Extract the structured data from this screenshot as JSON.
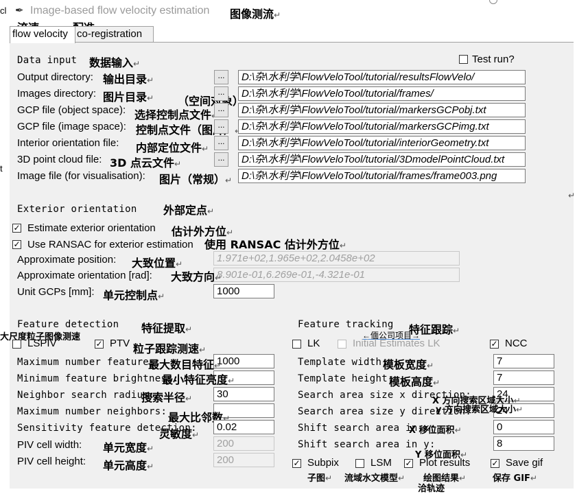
{
  "window": {
    "title": "Image-based flow velocity estimation",
    "title_zh": "图像测流",
    "edge_char_top": "cl",
    "edge_char_mid": "t"
  },
  "tabs": [
    {
      "label": "flow velocity",
      "zh": "流速"
    },
    {
      "label": "co-registration",
      "zh": "配准"
    }
  ],
  "data_input": {
    "heading": "Data input",
    "heading_zh": "数据输入",
    "test_run_label": "Test run?",
    "test_run_checked": false,
    "rows": [
      {
        "label": "Output directory:",
        "zh": "输出目录",
        "value": "D:\\杂\\水利学\\FlowVeloTool/tutorial/resultsFlowVelo/"
      },
      {
        "label": "Images directory:",
        "zh": "图片目录",
        "value": "D:\\杂\\水利学\\FlowVeloTool/tutorial/frames/"
      },
      {
        "label": "GCP file (object space):",
        "zh": "选择控制点文件",
        "value": "D:\\杂\\水利学\\FlowVeloTool/tutorial/markersGCPobj.txt"
      },
      {
        "label": "GCP file (image space):",
        "zh": "控制点文件（图片）",
        "value": "D:\\杂\\水利学\\FlowVeloTool/tutorial/markersGCPimg.txt"
      },
      {
        "label": "Interior orientation file:",
        "zh": "内部定位文件",
        "value": "D:\\杂\\水利学\\FlowVeloTool/tutorial/interiorGeometry.txt"
      },
      {
        "label": "3D point cloud file:",
        "zh": "3D 点云文件",
        "value": "D:\\杂\\水利学\\FlowVeloTool/tutorial/3DmodelPointCloud.txt"
      },
      {
        "label": "Image file (for visualisation):",
        "zh": "图片（常规）",
        "value": "D:\\杂\\水利学\\FlowVeloTool/tutorial/frames/frame003.png"
      }
    ],
    "object_space_zh": "（空间对象）",
    "browse_label": "..."
  },
  "exterior": {
    "heading": "Exterior orientation",
    "heading_zh": "外部定点",
    "estimate_label": "Estimate exterior orientation",
    "estimate_zh": "估计外方位",
    "estimate_checked": true,
    "ransac_label": "Use RANSAC for exterior estimation",
    "ransac_zh": "使用 RANSAC 估计外方位",
    "ransac_checked": true,
    "approx_pos_label": "Approximate position:",
    "approx_pos_zh": "大致位置",
    "approx_pos_value": "1.971e+02,1.965e+02,2.0458e+02",
    "approx_ori_label": "Approximate orientation [rad]:",
    "approx_ori_zh": "大致方向",
    "approx_ori_value": "8.901e-01,6.269e-01,-4.321e-01",
    "unit_label": "Unit GCPs [mm]:",
    "unit_zh": "单元控制点",
    "unit_value": "1000"
  },
  "feature_detection": {
    "heading": "Feature detection",
    "heading_zh": "特征提取",
    "lspiv_zh": "大尺度粒子图像测速",
    "lspiv_label": "LSPIV",
    "lspiv_checked": false,
    "ptv_label": "PTV",
    "ptv_zh": "粒子跟踪测速",
    "ptv_checked": true,
    "rows": [
      {
        "label": "Maximum number features:",
        "zh": "最大数目特征",
        "value": "1000",
        "disabled": false
      },
      {
        "label": "Minimum feature brightness:",
        "zh": "最小特征亮度",
        "value": "",
        "disabled": false
      },
      {
        "label": "Neighbor search radius:",
        "zh": "搜索半径",
        "value": "30",
        "disabled": false
      },
      {
        "label": "Maximum number neighbors:",
        "zh": "最大比邻数",
        "value": "",
        "disabled": false
      },
      {
        "label": "Sensitivity feature detection:",
        "zh": "灵敏度",
        "value": "0.02",
        "disabled": false
      },
      {
        "label": "PIV cell width:",
        "zh": "单元宽度",
        "value": "200",
        "disabled": true
      },
      {
        "label": "PIV cell height:",
        "zh": "单元高度",
        "value": "200",
        "disabled": true
      }
    ]
  },
  "feature_tracking": {
    "heading": "Feature tracking",
    "heading_zh": "特征跟踪",
    "note_zh": "←偭公司项目→",
    "lk_label": "LK",
    "lk_checked": false,
    "initial_label": "Initial Estimates LK",
    "initial_checked": false,
    "ncc_label": "NCC",
    "ncc_checked": true,
    "rows": [
      {
        "label": "Template width:",
        "zh": "模板宽度",
        "value": "7"
      },
      {
        "label": "Template height:",
        "zh": "模板高度",
        "value": "7"
      },
      {
        "label": "Search area size x direction:",
        "zh": "X 方向搜索区域大小",
        "value": "24"
      },
      {
        "label": "Search area size y direction:",
        "zh": "y 方向搜索区域大小",
        "value": "24"
      },
      {
        "label": "Shift search area in x:",
        "zh": "X 移位面积",
        "value": "0"
      },
      {
        "label": "Shift search area in y:",
        "zh": "Y 移位面积",
        "value": "8"
      }
    ]
  },
  "options": [
    {
      "label": "Subpix",
      "zh": "子图",
      "checked": true
    },
    {
      "label": "LSM",
      "zh": "流域水文模型",
      "checked": false
    },
    {
      "label": "Plot results",
      "zh": "绘图结果",
      "checked": true
    },
    {
      "label": "Save gif",
      "zh": "保存 GIF",
      "checked": true
    }
  ],
  "tail_zh": "洽轨迹",
  "return_mark": "↵"
}
